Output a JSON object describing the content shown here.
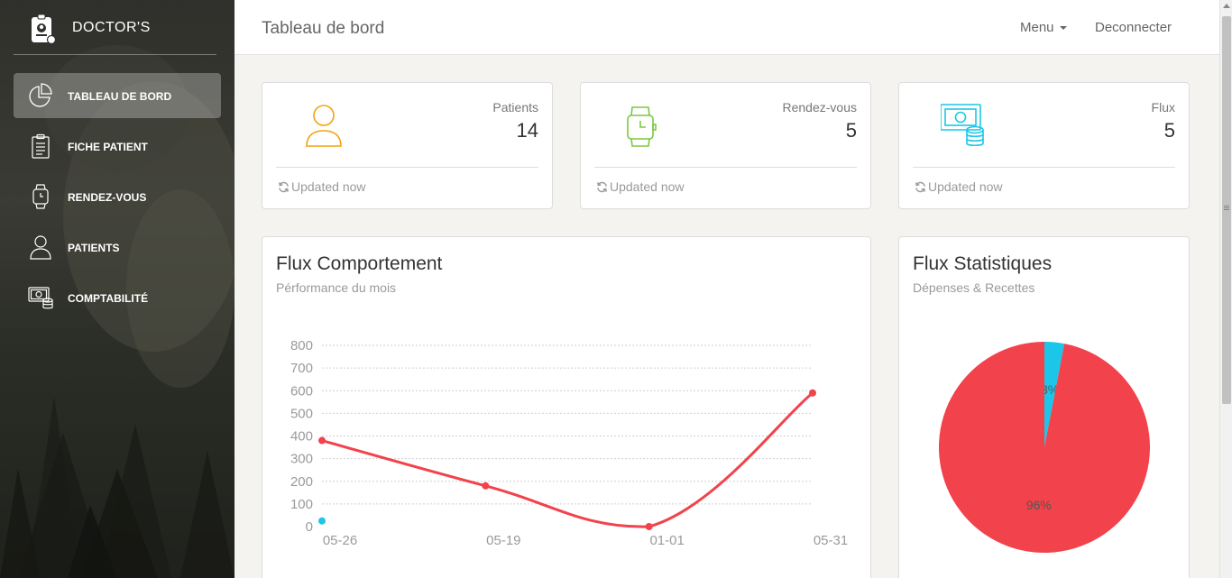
{
  "brand": {
    "name": "DOCTOR'S"
  },
  "sidebar": {
    "items": [
      {
        "label": "TABLEAU DE BORD",
        "icon": "pie-chart-icon",
        "active": true
      },
      {
        "label": "FICHE PATIENT",
        "icon": "clipboard-icon",
        "active": false
      },
      {
        "label": "RENDEZ-VOUS",
        "icon": "watch-icon",
        "active": false
      },
      {
        "label": "PATIENTS",
        "icon": "user-icon",
        "active": false
      },
      {
        "label": "COMPTABILITÉ",
        "icon": "money-coins-icon",
        "active": false
      }
    ]
  },
  "header": {
    "title": "Tableau de bord",
    "menu_label": "Menu",
    "logout_label": "Deconnecter"
  },
  "stats": [
    {
      "label": "Patients",
      "value": "14",
      "footer": "Updated now",
      "icon": "user-icon",
      "color": "#f3bb45"
    },
    {
      "label": "Rendez-vous",
      "value": "5",
      "footer": "Updated now",
      "icon": "watch-icon",
      "color": "#7ac29a"
    },
    {
      "label": "Flux",
      "value": "5",
      "footer": "Updated now",
      "icon": "money-coins-icon",
      "color": "#68b3c8"
    }
  ],
  "line_card": {
    "title": "Flux Comportement",
    "subtitle": "Pérformance du mois"
  },
  "pie_card": {
    "title": "Flux Statistiques",
    "subtitle": "Dépenses & Recettes"
  },
  "chart_data": [
    {
      "type": "line",
      "categories": [
        "05-26",
        "05-19",
        "01-01",
        "05-31"
      ],
      "series": [
        {
          "values": [
            380,
            180,
            0,
            590
          ],
          "color": "#eb5e28"
        },
        {
          "values": [
            25
          ],
          "color": "#1cc6e8"
        }
      ],
      "yticks": [
        0,
        100,
        200,
        300,
        400,
        500,
        600,
        700,
        800
      ],
      "ylim": [
        0,
        800
      ],
      "grid": true
    },
    {
      "type": "pie",
      "slices": [
        {
          "value": 3,
          "label": "3%",
          "color": "#1cc6e8"
        },
        {
          "value": 96,
          "label": "96%",
          "color": "#f2424c"
        }
      ]
    }
  ]
}
